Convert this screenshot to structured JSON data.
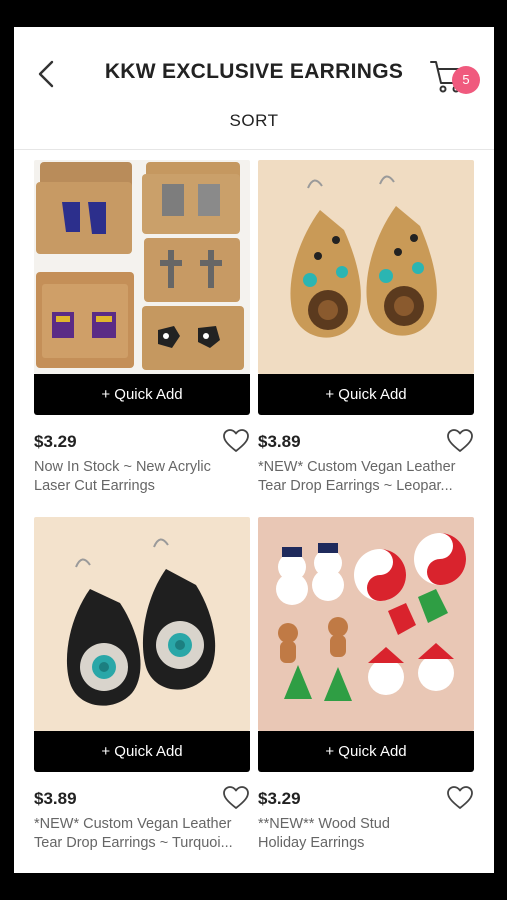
{
  "header": {
    "title": "KKW EXCLUSIVE EARRINGS",
    "sort_label": "SORT",
    "cart_count": "5"
  },
  "icons": {
    "back": "chevron-left-icon",
    "cart": "cart-icon",
    "favorite": "heart-outline-icon"
  },
  "colors": {
    "badge": "#f05a7e",
    "button_bg": "#000000",
    "price_text": "#222222",
    "name_text": "#666666"
  },
  "products": [
    {
      "quick_add": "+ Quick Add",
      "price": "$3.29",
      "name_line1": "Now In Stock ~ New Acrylic",
      "name_line2": "Laser Cut Earrings"
    },
    {
      "quick_add": "+ Quick Add",
      "price": "$3.89",
      "name_line1": "*NEW* Custom Vegan Leather",
      "name_line2": "Tear Drop Earrings ~ Leopar..."
    },
    {
      "quick_add": "+ Quick Add",
      "price": "$3.89",
      "name_line1": "*NEW* Custom Vegan Leather",
      "name_line2": "Tear Drop Earrings ~ Turquoi..."
    },
    {
      "quick_add": "+ Quick Add",
      "price": "$3.29",
      "name_line1": "**NEW** Wood Stud",
      "name_line2": "Holiday Earrings"
    }
  ]
}
